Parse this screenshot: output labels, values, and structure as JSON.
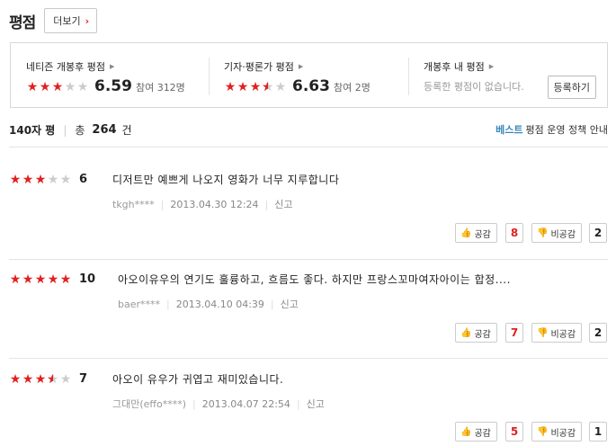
{
  "header": {
    "title": "평점",
    "more_label": "더보기"
  },
  "summary": {
    "netizen": {
      "title": "네티즌 개봉후 평점",
      "score": "6.59",
      "participants": "참여 312명",
      "stars": [
        "full",
        "full",
        "full",
        "empty",
        "empty"
      ]
    },
    "critic": {
      "title": "기자·평론가 평점",
      "score": "6.63",
      "participants": "참여 2명",
      "stars": [
        "full",
        "full",
        "full",
        "half",
        "empty"
      ]
    },
    "mine": {
      "title": "개봉후 내 평점",
      "text": "등록한 평점이 없습니다.",
      "register_label": "등록하기"
    }
  },
  "list_header": {
    "title": "140자 평",
    "total_label": "총",
    "total_count": "264",
    "unit": "건",
    "best_label": "베스트",
    "policy_label": "평점 운영 정책 안내"
  },
  "reviews": [
    {
      "stars": [
        "full",
        "full",
        "full",
        "empty",
        "empty"
      ],
      "score": "6",
      "text": "디저트만 예쁘게 나오지 영화가 너무 지루합니다",
      "user": "tkgh****",
      "date": "2013.04.30 12:24",
      "report": "신고",
      "like_label": "공감",
      "like_count": "8",
      "dislike_label": "비공감",
      "dislike_count": "2"
    },
    {
      "stars": [
        "full",
        "full",
        "full",
        "full",
        "full"
      ],
      "score": "10",
      "text": "아오이유우의 연기도 훌륭하고, 흐름도 좋다. 하지만 프랑스꼬마여자아이는 합정....",
      "user": "baer****",
      "date": "2013.04.10 04:39",
      "report": "신고",
      "like_label": "공감",
      "like_count": "7",
      "dislike_label": "비공감",
      "dislike_count": "2"
    },
    {
      "stars": [
        "full",
        "full",
        "full",
        "half",
        "empty"
      ],
      "score": "7",
      "text": "아오이 유우가 귀엽고 재미있습니다.",
      "user": "그대만(effo****)",
      "date": "2013.04.07 22:54",
      "report": "신고",
      "like_label": "공감",
      "like_count": "5",
      "dislike_label": "비공감",
      "dislike_count": "1"
    }
  ],
  "colors": {
    "accent": "#e0201f",
    "best": "#3a88b8",
    "icons": [
      "star-icon",
      "thumbs-up-icon",
      "thumbs-down-icon",
      "chevron-right-icon"
    ]
  }
}
